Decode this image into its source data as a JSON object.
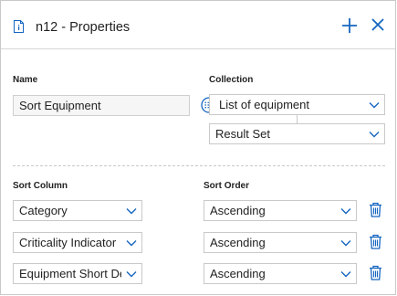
{
  "header": {
    "title": "n12 - Properties",
    "icons": {
      "doc": "document-info-icon",
      "add": "plus-icon",
      "close": "close-icon"
    }
  },
  "name": {
    "label": "Name",
    "value": "Sort Equipment"
  },
  "collection": {
    "label": "Collection",
    "selected": "List of equipment",
    "sub_selected": "Result Set"
  },
  "sort": {
    "column_label": "Sort Column",
    "order_label": "Sort Order",
    "rows": [
      {
        "column": "Category",
        "order": "Ascending"
      },
      {
        "column": "Criticality Indicator",
        "order": "Ascending"
      },
      {
        "column": "Equipment Short Description",
        "order": "Ascending"
      }
    ]
  },
  "colors": {
    "accent": "#1565c0",
    "border": "#c9c9c9",
    "input_bg": "#f6f6f6"
  }
}
